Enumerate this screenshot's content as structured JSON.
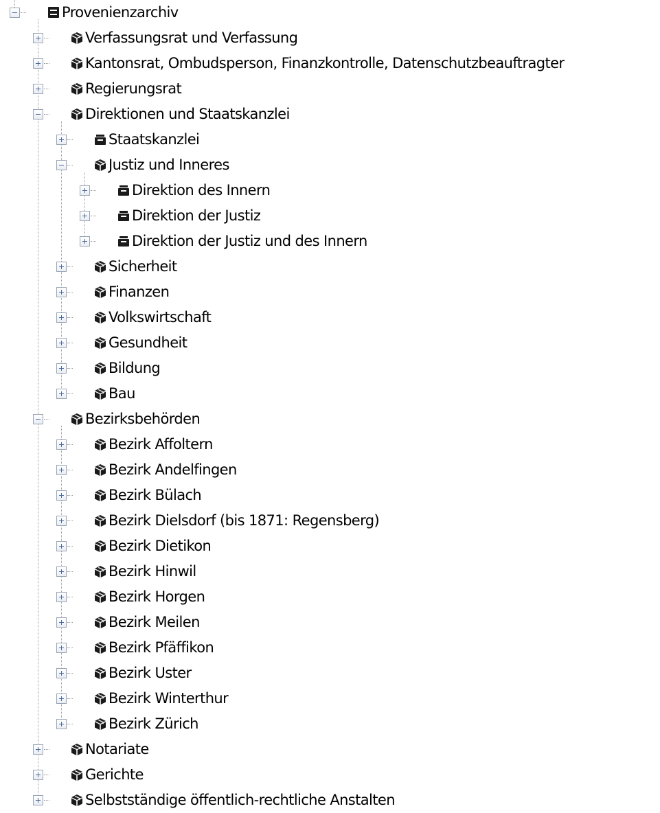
{
  "tree": {
    "nodes": [
      {
        "label": "Provenienzarchiv",
        "depth": 0,
        "expanded": true,
        "icon": "archive-icon"
      },
      {
        "label": "Verfassungsrat und Verfassung",
        "depth": 1,
        "expanded": false,
        "icon": "box-icon"
      },
      {
        "label": "Kantonsrat, Ombudsperson, Finanzkontrolle, Datenschutzbeauftragter",
        "depth": 1,
        "expanded": false,
        "icon": "box-icon"
      },
      {
        "label": "Regierungsrat",
        "depth": 1,
        "expanded": false,
        "icon": "box-icon"
      },
      {
        "label": "Direktionen und Staatskanzlei",
        "depth": 1,
        "expanded": true,
        "icon": "box-icon"
      },
      {
        "label": "Staatskanzlei",
        "depth": 2,
        "expanded": false,
        "icon": "drawer-icon"
      },
      {
        "label": "Justiz und Inneres",
        "depth": 2,
        "expanded": true,
        "icon": "box-icon"
      },
      {
        "label": "Direktion des Innern",
        "depth": 3,
        "expanded": false,
        "icon": "drawer-icon"
      },
      {
        "label": "Direktion der Justiz",
        "depth": 3,
        "expanded": false,
        "icon": "drawer-icon"
      },
      {
        "label": "Direktion der Justiz und des Innern",
        "depth": 3,
        "expanded": false,
        "icon": "drawer-icon"
      },
      {
        "label": "Sicherheit",
        "depth": 2,
        "expanded": false,
        "icon": "box-icon"
      },
      {
        "label": "Finanzen",
        "depth": 2,
        "expanded": false,
        "icon": "box-icon"
      },
      {
        "label": "Volkswirtschaft",
        "depth": 2,
        "expanded": false,
        "icon": "box-icon"
      },
      {
        "label": "Gesundheit",
        "depth": 2,
        "expanded": false,
        "icon": "box-icon"
      },
      {
        "label": "Bildung",
        "depth": 2,
        "expanded": false,
        "icon": "box-icon"
      },
      {
        "label": "Bau",
        "depth": 2,
        "expanded": false,
        "icon": "box-icon"
      },
      {
        "label": "Bezirksbehörden",
        "depth": 1,
        "expanded": true,
        "icon": "box-icon"
      },
      {
        "label": "Bezirk Affoltern",
        "depth": 2,
        "expanded": false,
        "icon": "box-icon"
      },
      {
        "label": "Bezirk Andelfingen",
        "depth": 2,
        "expanded": false,
        "icon": "box-icon"
      },
      {
        "label": "Bezirk Bülach",
        "depth": 2,
        "expanded": false,
        "icon": "box-icon"
      },
      {
        "label": "Bezirk Dielsdorf (bis 1871: Regensberg)",
        "depth": 2,
        "expanded": false,
        "icon": "box-icon"
      },
      {
        "label": "Bezirk Dietikon",
        "depth": 2,
        "expanded": false,
        "icon": "box-icon"
      },
      {
        "label": "Bezirk Hinwil",
        "depth": 2,
        "expanded": false,
        "icon": "box-icon"
      },
      {
        "label": "Bezirk Horgen",
        "depth": 2,
        "expanded": false,
        "icon": "box-icon"
      },
      {
        "label": "Bezirk Meilen",
        "depth": 2,
        "expanded": false,
        "icon": "box-icon"
      },
      {
        "label": "Bezirk Pfäffikon",
        "depth": 2,
        "expanded": false,
        "icon": "box-icon"
      },
      {
        "label": "Bezirk Uster",
        "depth": 2,
        "expanded": false,
        "icon": "box-icon"
      },
      {
        "label": "Bezirk Winterthur",
        "depth": 2,
        "expanded": false,
        "icon": "box-icon"
      },
      {
        "label": "Bezirk Zürich",
        "depth": 2,
        "expanded": false,
        "icon": "box-icon"
      },
      {
        "label": "Notariate",
        "depth": 1,
        "expanded": false,
        "icon": "box-icon"
      },
      {
        "label": "Gerichte",
        "depth": 1,
        "expanded": false,
        "icon": "box-icon"
      },
      {
        "label": "Selbstständige öffentlich-rechtliche Anstalten",
        "depth": 1,
        "expanded": false,
        "icon": "box-icon"
      }
    ]
  }
}
